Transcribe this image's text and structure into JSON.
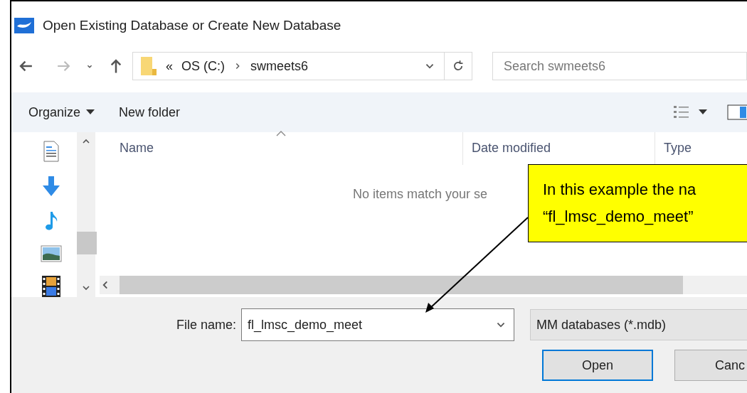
{
  "window": {
    "title": "Open Existing Database or Create New Database"
  },
  "address_bar": {
    "overflow": "«",
    "path": [
      {
        "label": "OS (C:)"
      },
      {
        "label": "swmeets6"
      }
    ]
  },
  "search": {
    "placeholder": "Search swmeets6"
  },
  "toolbar": [
    {
      "label": "Organize",
      "dropdown": true
    },
    {
      "label": "New folder",
      "dropdown": false
    }
  ],
  "sidebar": {
    "items": [
      {
        "kind": "documents"
      },
      {
        "kind": "downloads"
      },
      {
        "kind": "music"
      },
      {
        "kind": "pictures"
      },
      {
        "kind": "videos"
      }
    ]
  },
  "table": {
    "columns": [
      {
        "label": "Name",
        "sorted": true
      },
      {
        "label": "Date modified",
        "sorted": false
      },
      {
        "label": "Type",
        "sorted": false
      }
    ],
    "empty_message": "No items match your se"
  },
  "file_name": {
    "label": "File name:",
    "value": "fl_lmsc_demo_meet"
  },
  "file_type": {
    "value": "MM databases (*.mdb)"
  },
  "buttons": [
    {
      "label": "Open",
      "default": true
    },
    {
      "label": "Canc",
      "default": false
    }
  ],
  "callout": {
    "lines": [
      "In this example the na",
      "“fl_lmsc_demo_meet”"
    ]
  }
}
